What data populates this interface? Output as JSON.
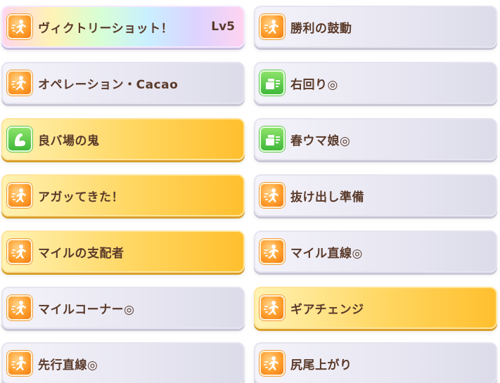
{
  "skills": [
    {
      "label": "ヴィクトリーショット！",
      "level": "Lv5",
      "style": "rainbow",
      "icon": "speed-icon"
    },
    {
      "label": "勝利の鼓動",
      "style": "silver",
      "icon": "speed-icon"
    },
    {
      "label": "オペレーション・Cacao",
      "style": "silver",
      "icon": "speed-icon"
    },
    {
      "label": "右回り◎",
      "style": "silver",
      "icon": "green-stat-icon"
    },
    {
      "label": "良バ場の鬼",
      "style": "gold",
      "icon": "green-stat-icon"
    },
    {
      "label": "春ウマ娘◎",
      "style": "silver",
      "icon": "green-stat-icon"
    },
    {
      "label": "アガッてきた！",
      "style": "gold",
      "icon": "speed-icon"
    },
    {
      "label": "抜け出し準備",
      "style": "silver",
      "icon": "speed-icon"
    },
    {
      "label": "マイルの支配者",
      "style": "gold",
      "icon": "speed-icon"
    },
    {
      "label": "マイル直線◎",
      "style": "silver",
      "icon": "speed-icon"
    },
    {
      "label": "マイルコーナー◎",
      "style": "silver",
      "icon": "speed-icon"
    },
    {
      "label": "ギアチェンジ",
      "style": "gold",
      "icon": "speed-icon"
    },
    {
      "label": "先行直線◎",
      "style": "silver",
      "icon": "speed-icon"
    },
    {
      "label": "尻尾上がり",
      "style": "silver",
      "icon": "speed-icon"
    }
  ]
}
